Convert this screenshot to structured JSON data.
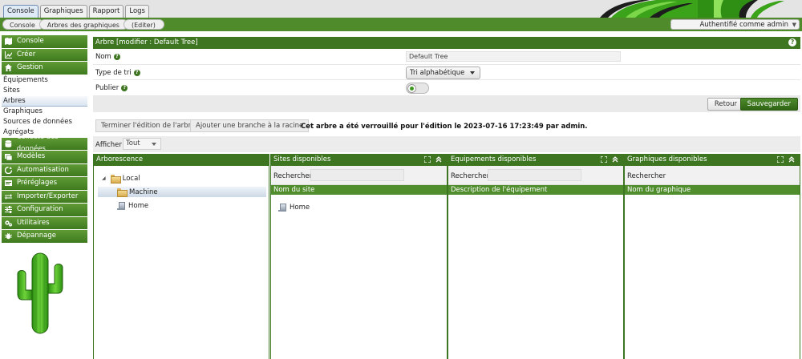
{
  "tabs": [
    {
      "label": "Console",
      "active": true
    },
    {
      "label": "Graphiques",
      "active": false
    },
    {
      "label": "Rapport",
      "active": false
    },
    {
      "label": "Logs",
      "active": false
    }
  ],
  "breadcrumb": [
    "Console",
    "Arbres des graphiques",
    "(Editer)"
  ],
  "auth_text": "Authentifié comme admin",
  "sidebar": {
    "sections": [
      {
        "label": "Console",
        "icon": "map-icon"
      },
      {
        "label": "Créer",
        "icon": "chart-icon"
      },
      {
        "label": "Gestion",
        "icon": "home-icon"
      }
    ],
    "gestion_items": [
      "Équipements",
      "Sites",
      "Arbres",
      "Graphiques",
      "Sources de données",
      "Agrégats"
    ],
    "selected_item": "Arbres",
    "sections_after": [
      {
        "label": "Collecte des données",
        "icon": "database-icon"
      },
      {
        "label": "Modèles",
        "icon": "templates-icon"
      },
      {
        "label": "Automatisation",
        "icon": "automation-icon"
      },
      {
        "label": "Préréglages",
        "icon": "presets-icon"
      },
      {
        "label": "Importer/Exporter",
        "icon": "import-export-icon"
      },
      {
        "label": "Configuration",
        "icon": "sliders-icon"
      },
      {
        "label": "Utilitaires",
        "icon": "gears-icon"
      },
      {
        "label": "Dépannage",
        "icon": "bug-icon"
      }
    ]
  },
  "tree_panel": {
    "title": "Arbre [modifier : Default Tree]",
    "help": "?",
    "name_label": "Nom",
    "name_value": "Default Tree",
    "sort_label": "Type de tri",
    "sort_value": "Tri alphabétique",
    "publish_label": "Publier",
    "publish_on": true,
    "return_label": "Retour",
    "save_label": "Sauvegarder"
  },
  "toolbar": {
    "finish_edit": "Terminer l'édition de l'arbre",
    "add_branch": "Ajouter une branche à la racine",
    "lock_message": "Cet arbre a été verrouillé pour l'édition le 2023-07-16 17:23:49 par admin."
  },
  "show": {
    "label": "Afficher",
    "value": "Tout"
  },
  "columns": {
    "tree": {
      "title": "Arborescence",
      "items": [
        {
          "label": "Local",
          "type": "folder"
        },
        {
          "label": "Machine",
          "type": "folder"
        },
        {
          "label": "Home",
          "type": "host"
        }
      ]
    },
    "sites": {
      "title": "Sites disponibles",
      "search_label": "Rechercher",
      "header": "Nom du site",
      "items": [
        "Home"
      ]
    },
    "devices": {
      "title": "Equipements disponibles",
      "search_label": "Rechercher",
      "header": "Description de l'équipement"
    },
    "graphs": {
      "title": "Graphiques disponibles",
      "search_label": "Rechercher",
      "header": "Nom du graphique"
    }
  },
  "colors": {
    "brand_green": "#3d7520",
    "header_green": "#4f8b2a"
  }
}
